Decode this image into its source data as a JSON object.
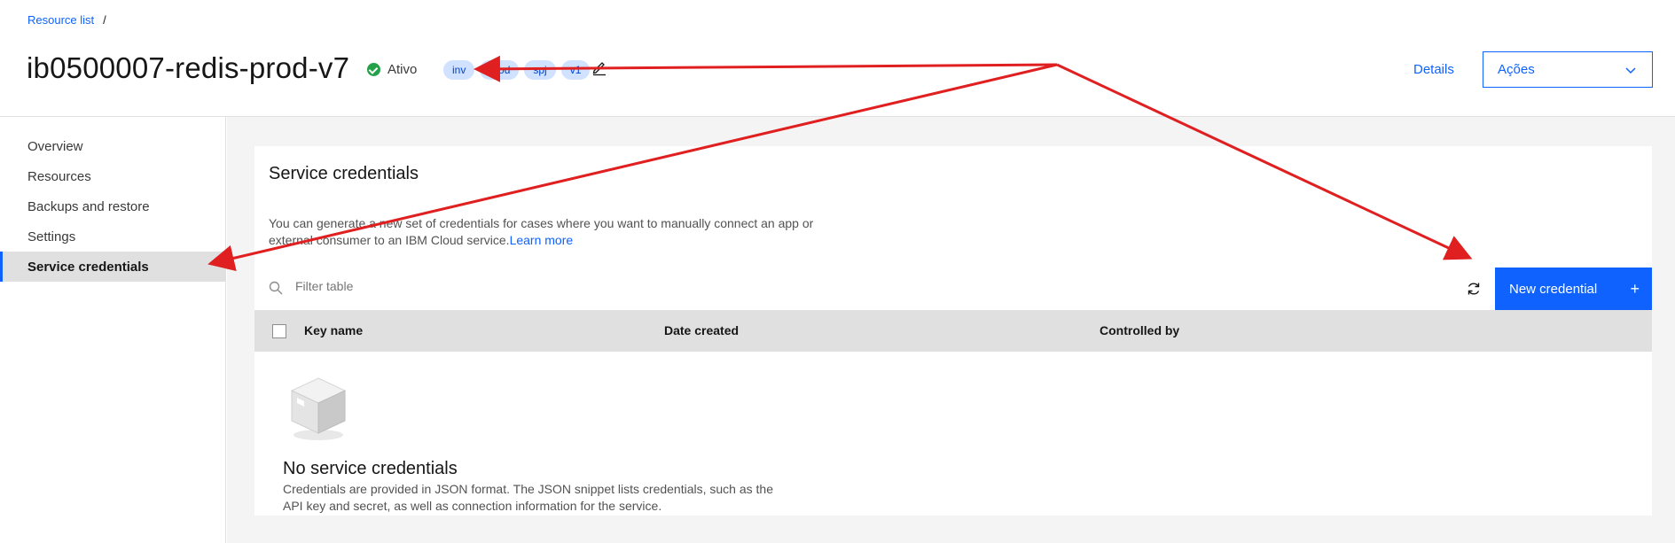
{
  "breadcrumb": {
    "link": "Resource list",
    "separator": "/"
  },
  "header": {
    "title": "ib0500007-redis-prod-v7",
    "status": "Ativo",
    "tags": [
      "inv",
      "prod",
      "spj",
      "v1"
    ],
    "details_link": "Details",
    "actions_label": "Ações"
  },
  "sidebar": {
    "items": [
      {
        "label": "Overview"
      },
      {
        "label": "Resources"
      },
      {
        "label": "Backups and restore"
      },
      {
        "label": "Settings"
      },
      {
        "label": "Service credentials"
      }
    ]
  },
  "card": {
    "title": "Service credentials",
    "desc_line1": "You can generate a new set of credentials for cases where you want to manually connect an app or",
    "desc_line2": "external consumer to an IBM Cloud service.",
    "learn_more": "Learn more",
    "filter_placeholder": "Filter table",
    "new_credential": "New credential",
    "columns": [
      "Key name",
      "Date created",
      "Controlled by"
    ],
    "empty_title": "No service credentials",
    "empty_desc_line1": "Credentials are provided in JSON format. The JSON snippet lists credentials, such as the",
    "empty_desc_line2": "API key and secret, as well as connection information for the service."
  },
  "colors": {
    "accent": "#0f62fe",
    "status_ok": "#24a148",
    "annotation": "#e02020",
    "tag_bg": "#d0e2ff"
  },
  "icons": [
    "edit-icon",
    "chevron-down-icon",
    "search-icon",
    "refresh-icon",
    "plus-icon",
    "empty-box-icon",
    "status-check-icon"
  ]
}
